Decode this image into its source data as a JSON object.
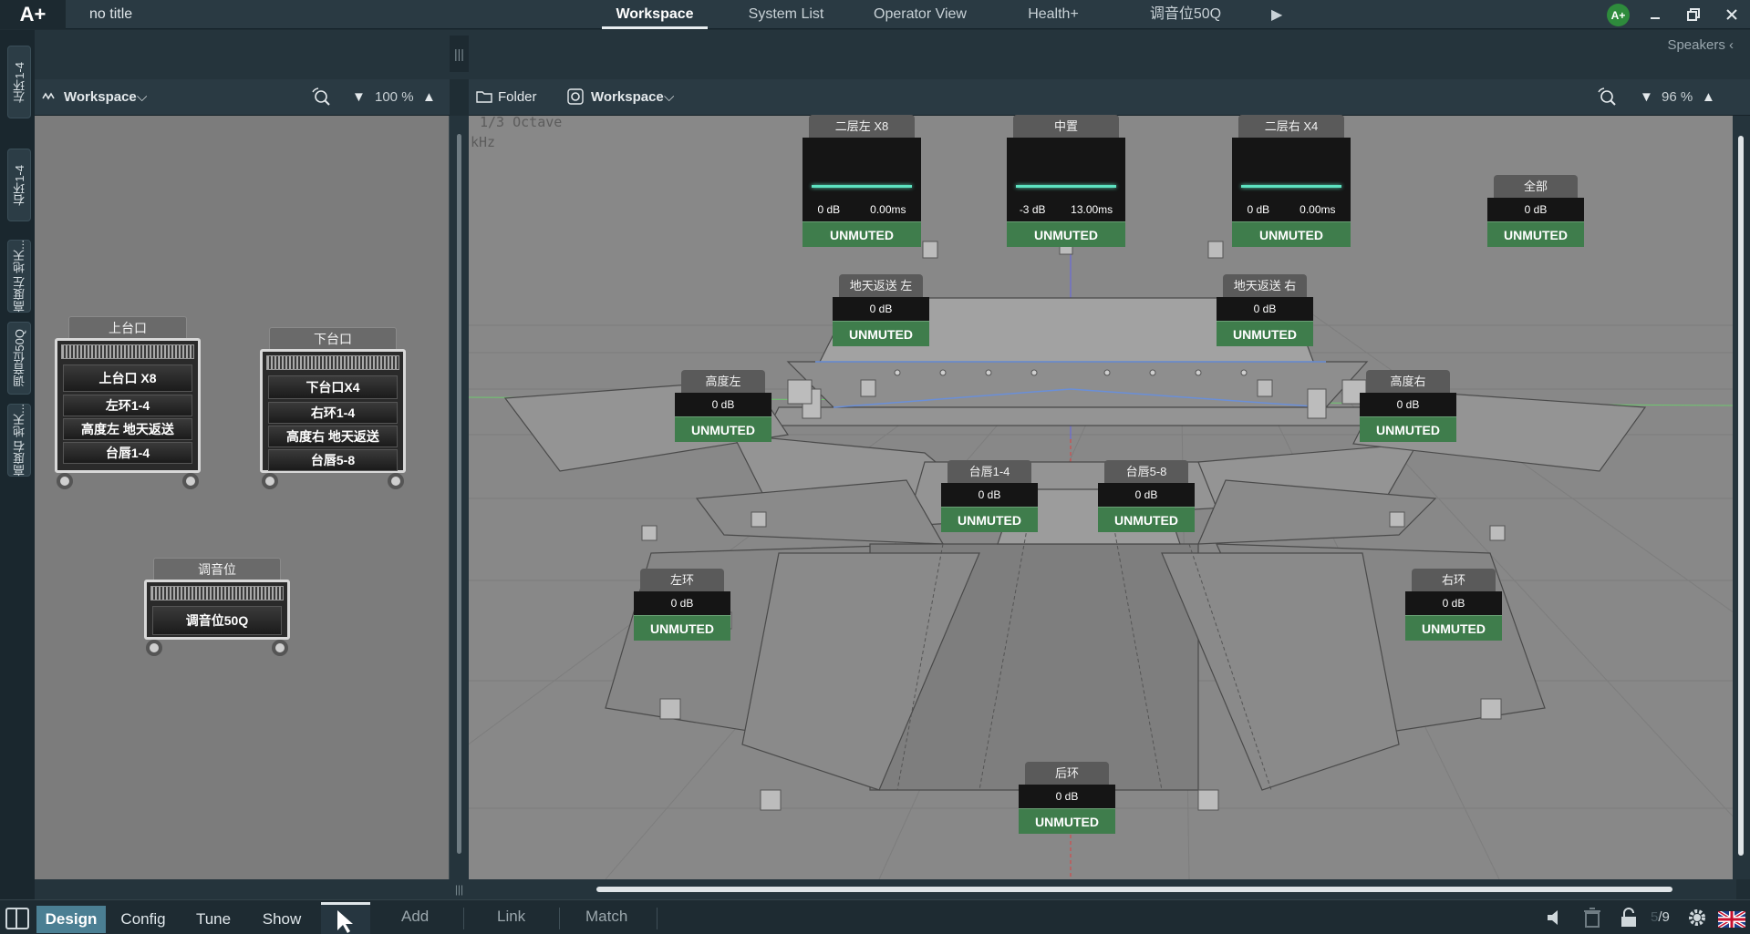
{
  "titlebar": {
    "logo": "A+",
    "doc_title": "no title",
    "tabs": [
      {
        "label": "Workspace",
        "active": true
      },
      {
        "label": "System List"
      },
      {
        "label": "Operator View"
      },
      {
        "label": "Health+"
      },
      {
        "label": "调音位50Q"
      }
    ],
    "play_icon": "play-icon",
    "badge": "A+",
    "window_icons": [
      "minimize-icon",
      "restore-icon",
      "close-icon"
    ]
  },
  "subbar": {
    "speakers_label": "Speakers"
  },
  "vertical_tabs": [
    "左环1-4",
    "右环1-4",
    "高度左 地天...",
    "调音位50Q",
    "高度右 地天..."
  ],
  "left_panel": {
    "header": {
      "title": "Workspace",
      "zoom": "100 %"
    },
    "racks": [
      {
        "title": "上台口",
        "units": [
          "上台口 X8",
          "左环1-4",
          "高度左 地天返送",
          "台唇1-4"
        ]
      },
      {
        "title": "下台口",
        "units": [
          "下台口X4",
          "右环1-4",
          "高度右 地天返送",
          "台唇5-8"
        ]
      },
      {
        "title": "调音位",
        "units": [
          "调音位50Q"
        ]
      }
    ]
  },
  "workspace": {
    "header": {
      "folder": "Folder",
      "title": "Workspace",
      "zoom": "96 %"
    },
    "octave_label": "1/3 Octave",
    "khz_label": "kHz",
    "channels": [
      {
        "name": "二层左 X8",
        "db": "0 dB",
        "delay": "0.00ms",
        "state": "UNMUTED"
      },
      {
        "name": "中置",
        "db": "-3 dB",
        "delay": "13.00ms",
        "state": "UNMUTED"
      },
      {
        "name": "二层右 X4",
        "db": "0 dB",
        "delay": "0.00ms",
        "state": "UNMUTED"
      },
      {
        "name": "全部",
        "db": "0 dB",
        "state": "UNMUTED"
      },
      {
        "name": "地天返送 左",
        "db": "0 dB",
        "state": "UNMUTED"
      },
      {
        "name": "地天返送 右",
        "db": "0 dB",
        "state": "UNMUTED"
      },
      {
        "name": "高度左",
        "db": "0 dB",
        "state": "UNMUTED"
      },
      {
        "name": "高度右",
        "db": "0 dB",
        "state": "UNMUTED"
      },
      {
        "name": "台唇1-4",
        "db": "0 dB",
        "state": "UNMUTED"
      },
      {
        "name": "台唇5-8",
        "db": "0 dB",
        "state": "UNMUTED"
      },
      {
        "name": "左环",
        "db": "0 dB",
        "state": "UNMUTED"
      },
      {
        "name": "右环",
        "db": "0 dB",
        "state": "UNMUTED"
      },
      {
        "name": "后环",
        "db": "0 dB",
        "state": "UNMUTED"
      }
    ]
  },
  "bottombar": {
    "mode_tabs": [
      {
        "label": "Design",
        "active": true
      },
      {
        "label": "Config"
      },
      {
        "label": "Tune"
      },
      {
        "label": "Show"
      }
    ],
    "tools": [
      "Add",
      "Link",
      "Match"
    ],
    "page_counter": "/9",
    "page_counter_faint": "5"
  }
}
